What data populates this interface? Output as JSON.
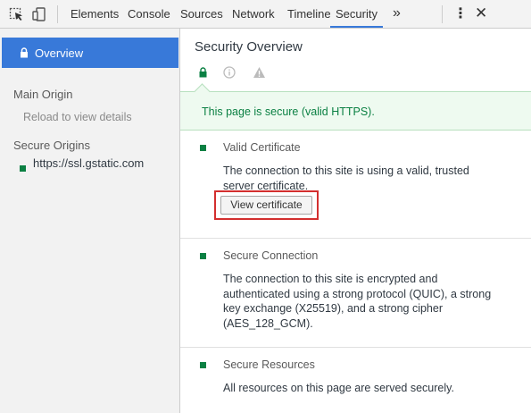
{
  "toolbar": {
    "tabs": [
      "Elements",
      "Console",
      "Sources",
      "Network",
      "Timeline",
      "Security"
    ],
    "active_tab": "Security",
    "more": "»",
    "menu": "⋮",
    "close": "✕",
    "accent_color": "#3879d9"
  },
  "sidebar": {
    "overview_label": "Overview",
    "main_origin_heading": "Main Origin",
    "main_origin_hint": "Reload to view details",
    "secure_origins_heading": "Secure Origins",
    "secure_origin": "https://ssl.gstatic.com"
  },
  "main": {
    "title": "Security Overview",
    "summary_icons": [
      "lock-icon",
      "info-icon",
      "warning-icon"
    ],
    "banner": "This page is secure (valid HTTPS).",
    "sections": [
      {
        "heading": "Valid Certificate",
        "description": "The connection to this site is using a valid, trusted server certificate.",
        "button": "View certificate"
      },
      {
        "heading": "Secure Connection",
        "description": "The connection to this site is encrypted and authenticated using a strong protocol (QUIC), a strong key exchange (X25519), and a strong cipher (AES_128_GCM)."
      },
      {
        "heading": "Secure Resources",
        "description": "All resources on this page are served securely."
      }
    ],
    "secure_color": "#0b8043"
  }
}
